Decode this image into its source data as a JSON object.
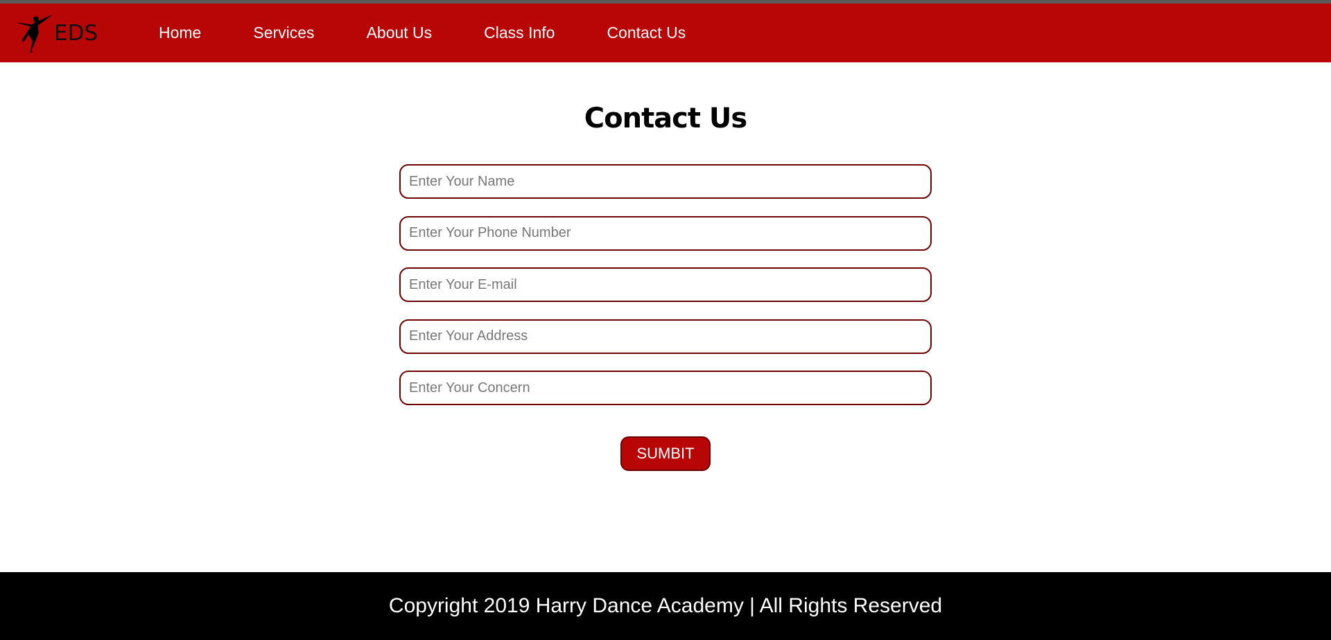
{
  "header": {
    "brand": "EDS",
    "brand_icon": "dancer-icon",
    "nav": [
      {
        "label": "Home"
      },
      {
        "label": "Services"
      },
      {
        "label": "About Us"
      },
      {
        "label": "Class Info"
      },
      {
        "label": "Contact Us"
      }
    ]
  },
  "main": {
    "title": "Contact Us",
    "fields": [
      {
        "placeholder": "Enter Your Name",
        "value": ""
      },
      {
        "placeholder": "Enter Your Phone Number",
        "value": ""
      },
      {
        "placeholder": "Enter Your E-mail",
        "value": ""
      },
      {
        "placeholder": "Enter Your Address",
        "value": ""
      },
      {
        "placeholder": "Enter Your Concern",
        "value": ""
      }
    ],
    "submit_label": "SUMBIT"
  },
  "footer": {
    "text": "Copyright 2019 Harry Dance Academy | All Rights Reserved"
  },
  "colors": {
    "brand_red": "#b80606",
    "border_dark_red": "#6d0000",
    "footer_bg": "#000000"
  }
}
